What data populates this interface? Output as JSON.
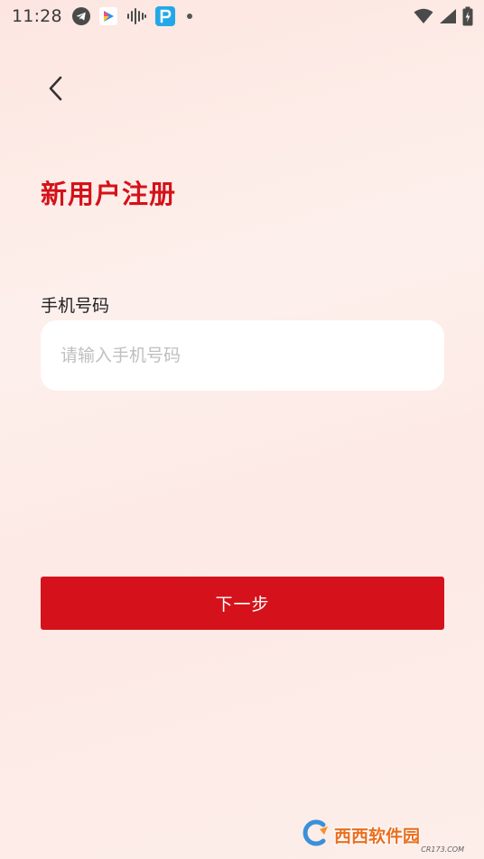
{
  "status_bar": {
    "time": "11:28",
    "left_icons": [
      "telegram-icon",
      "video-app-icon",
      "audio-waveform-icon",
      "parking-app-icon",
      "dot-icon"
    ],
    "right_icons": [
      "wifi-icon",
      "cellular-signal-icon",
      "battery-charging-icon"
    ]
  },
  "header": {
    "back_icon": "chevron-left-icon"
  },
  "page": {
    "title": "新用户注册",
    "phone_label": "手机号码",
    "phone_placeholder": "请输入手机号码",
    "phone_value": "",
    "next_label": "下一步"
  },
  "watermark": {
    "text": "西西软件园",
    "sub": "CR173.COM"
  },
  "colors": {
    "accent": "#d5121b",
    "title": "#d41219",
    "background": "#fdeeea"
  }
}
